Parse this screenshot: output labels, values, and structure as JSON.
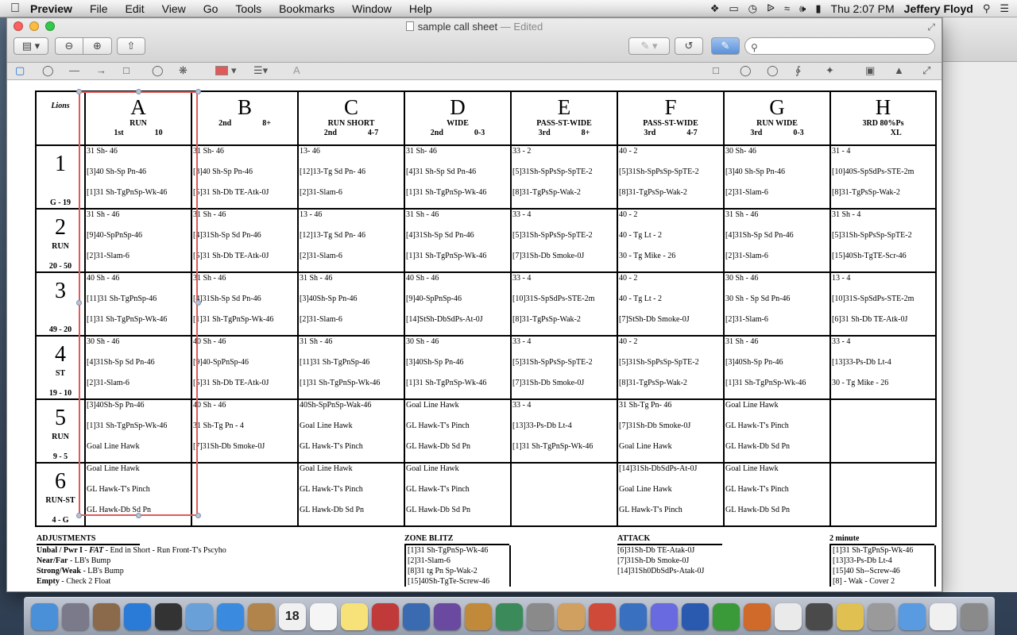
{
  "menubar": {
    "app": "Preview",
    "items": [
      "File",
      "Edit",
      "View",
      "Go",
      "Tools",
      "Bookmarks",
      "Window",
      "Help"
    ],
    "clock": "Thu 2:07 PM",
    "user": "Jeffery Floyd"
  },
  "window": {
    "title": "sample call sheet",
    "status": "Edited",
    "sep": "—"
  },
  "sheet": {
    "team": "Lions",
    "columns": [
      {
        "letter": "A",
        "name": "RUN",
        "down": "1st",
        "dist": "10"
      },
      {
        "letter": "B",
        "name": "",
        "down": "2nd",
        "dist": "8+"
      },
      {
        "letter": "C",
        "name": "RUN SHORT",
        "down": "2nd",
        "dist": "4-7"
      },
      {
        "letter": "D",
        "name": "WIDE",
        "down": "2nd",
        "dist": "0-3"
      },
      {
        "letter": "E",
        "name": "PASS-ST-WIDE",
        "down": "3rd",
        "dist": "8+"
      },
      {
        "letter": "F",
        "name": "PASS-ST-WIDE",
        "down": "3rd",
        "dist": "4-7"
      },
      {
        "letter": "G",
        "name": "RUN WIDE",
        "down": "3rd",
        "dist": "0-3"
      },
      {
        "letter": "H",
        "name": "3RD 80%Ps",
        "down": "",
        "dist": "XL"
      }
    ],
    "rows": [
      {
        "num": "1",
        "label": "",
        "range": "G - 19",
        "cells": [
          [
            "31 Sh- 46",
            "[3]40 Sh-Sp Pn-46",
            "[1]31 Sh-TgPnSp-Wk-46"
          ],
          [
            "31 Sh- 46",
            "[3]40 Sh-Sp Pn-46",
            "[5]31 Sh-Db TE-Atk-0J"
          ],
          [
            "13- 46",
            "[12]13-Tg Sd Pn- 46",
            "[2]31-Slam-6"
          ],
          [
            "31 Sh- 46",
            "[4]31 Sh-Sp Sd Pn-46",
            "[1]31 Sh-TgPnSp-Wk-46"
          ],
          [
            "33 - 2",
            "[5]31Sh-SpPsSp-SpTE-2",
            "[8]31-TgPsSp-Wak-2"
          ],
          [
            "40 - 2",
            "[5]31Sh-SpPsSp-SpTE-2",
            "[8]31-TgPsSp-Wak-2"
          ],
          [
            "30 Sh- 46",
            "[3]40 Sh-Sp Pn-46",
            "[2]31-Slam-6"
          ],
          [
            "31 - 4",
            "[10]40S-SpSdPs-STE-2m",
            "[8]31-TgPsSp-Wak-2"
          ]
        ]
      },
      {
        "num": "2",
        "label": "RUN",
        "range": "20 - 50",
        "cells": [
          [
            "31 Sh - 46",
            "[9]40-SpPnSp-46",
            "[2]31-Slam-6"
          ],
          [
            "31 Sh - 46",
            "[4]31Sh-Sp Sd Pn-46",
            "[5]31 Sh-Db TE-Atk-0J"
          ],
          [
            "13 - 46",
            "[12]13-Tg Sd Pn- 46",
            "[2]31-Slam-6"
          ],
          [
            "31 Sh - 46",
            "[4]31Sh-Sp Sd Pn-46",
            "[1]31 Sh-TgPnSp-Wk-46"
          ],
          [
            "33 - 4",
            "[5]31Sh-SpPsSp-SpTE-2",
            "[7]31Sh-Db Smoke-0J"
          ],
          [
            "40 - 2",
            "40 - Tg Lt - 2",
            "30 - Tg Mike - 26"
          ],
          [
            "31 Sh - 46",
            "[4]31Sh-Sp Sd Pn-46",
            "[2]31-Slam-6"
          ],
          [
            "31 Sh - 4",
            "[5]31Sh-SpPsSp-SpTE-2",
            "[15]40Sh-TgTE-Scr-46"
          ]
        ]
      },
      {
        "num": "3",
        "label": "",
        "range": "49 - 20",
        "cells": [
          [
            "40 Sh - 46",
            "[11]31 Sh-TgPnSp-46",
            "[1]31 Sh-TgPnSp-Wk-46"
          ],
          [
            "31 Sh - 46",
            "[4]31Sh-Sp Sd Pn-46",
            "[1]31 Sh-TgPnSp-Wk-46"
          ],
          [
            "31 Sh - 46",
            "[3]40Sh-Sp Pn-46",
            "[2]31-Slam-6"
          ],
          [
            "40 Sh - 46",
            "[9]40-SpPnSp-46",
            "[14]StSh-DbSdPs-At-0J"
          ],
          [
            "33 - 4",
            "[10]31S-SpSdPs-STE-2m",
            "[8]31-TgPsSp-Wak-2"
          ],
          [
            "40 - 2",
            "40 - Tg Lt - 2",
            "[7]StSh-Db Smoke-0J"
          ],
          [
            "30 Sh - 46",
            "30 Sh - Sp Sd Pn-46",
            "[2]31-Slam-6"
          ],
          [
            "13 - 4",
            "[10]31S-SpSdPs-STE-2m",
            "[6]31 Sh-Db TE-Atk-0J"
          ]
        ]
      },
      {
        "num": "4",
        "label": "ST",
        "range": "19 - 10",
        "cells": [
          [
            "30 Sh - 46",
            "[4]31Sh-Sp Sd Pn-46",
            "[2]31-Slam-6"
          ],
          [
            "40 Sh - 46",
            "[9]40-SpPnSp-46",
            "[5]31 Sh-Db TE-Atk-0J"
          ],
          [
            "31 Sh - 46",
            "[11]31 Sh-TgPnSp-46",
            "[1]31 Sh-TgPnSp-Wk-46"
          ],
          [
            "30 Sh - 46",
            "[3]40Sh-Sp Pn-46",
            "[1]31 Sh-TgPnSp-Wk-46"
          ],
          [
            "33 - 4",
            "[5]31Sh-SpPsSp-SpTE-2",
            "[7]31Sh-Db Smoke-0J"
          ],
          [
            "40 - 2",
            "[5]31Sh-SpPsSp-SpTE-2",
            "[8]31-TgPsSp-Wak-2"
          ],
          [
            "31 Sh - 46",
            "[3]40Sh-Sp Pn-46",
            "[1]31 Sh-TgPnSp-Wk-46"
          ],
          [
            "33 - 4",
            "[13]33-Ps-Db Lt-4",
            "30 - Tg Mike - 26"
          ]
        ]
      },
      {
        "num": "5",
        "label": "RUN",
        "range": "9 - 5",
        "cells": [
          [
            "[3]40Sh-Sp Pn-46",
            "[1]31 Sh-TgPnSp-Wk-46",
            "Goal Line Hawk"
          ],
          [
            "40 Sh - 46",
            "31 Sh-Tg Pn - 4",
            "[7]31Sh-Db Smoke-0J"
          ],
          [
            "40Sh-SpPnSp-Wak-46",
            "Goal Line Hawk",
            "GL Hawk-T's Pinch"
          ],
          [
            "Goal Line Hawk",
            "GL Hawk-T's Pinch",
            "GL Hawk-Db Sd Pn"
          ],
          [
            "33 - 4",
            "[13]33-Ps-Db Lt-4",
            "[1]31 Sh-TgPnSp-Wk-46"
          ],
          [
            "31 Sh-Tg Pn- 46",
            "[7]31Sh-Db Smoke-0J",
            "Goal Line Hawk"
          ],
          [
            "Goal Line Hawk",
            "GL Hawk-T's Pinch",
            "GL Hawk-Db Sd Pn"
          ],
          []
        ]
      },
      {
        "num": "6",
        "label": "RUN-ST",
        "range": "4 - G",
        "cells": [
          [
            "Goal Line Hawk",
            "GL Hawk-T's Pinch",
            "GL Hawk-Db Sd Pn"
          ],
          [],
          [
            "Goal Line Hawk",
            "GL Hawk-T's Pinch",
            "GL Hawk-Db Sd Pn"
          ],
          [
            "Goal Line Hawk",
            "GL Hawk-T's Pinch",
            "GL Hawk-Db Sd Pn"
          ],
          [],
          [
            "[14]31Sh-DbSdPs-At-0J",
            "Goal Line Hawk",
            "GL Hawk-T's Pinch"
          ],
          [
            "Goal Line Hawk",
            "GL Hawk-T's Pinch",
            "GL Hawk-Db Sd Pn"
          ],
          []
        ]
      }
    ]
  },
  "adjustments": {
    "title": "ADJUSTMENTS",
    "lines": [
      {
        "key": "Unbal / Pwr I",
        "em": "FAT",
        "text": " - End in Short - Run Front-T's Pscyho"
      },
      {
        "key": "Near/Far",
        "em": "",
        "text": " - LB's Bump"
      },
      {
        "key": "Strong/Weak",
        "em": "",
        "text": " - LB's Bump"
      },
      {
        "key": "Empty",
        "em": "",
        "text": " - Check 2 Float"
      }
    ]
  },
  "zone_blitz": {
    "title": "ZONE BLITZ",
    "lines": [
      "[1]31 Sh-TgPnSp-Wk-46",
      "[2]31-Slam-6",
      "[8]31 tg Pn Sp-Wak-2",
      "[15]40Sh-TgTe-Screw-46"
    ]
  },
  "attack": {
    "title": "ATTACK",
    "lines": [
      "[6]31Sh-Db TE-Atak-0J",
      "[7]31Sh-Db Smoke-0J",
      "[14]31Sh0DbSdPs-Atak-0J"
    ]
  },
  "two_minute": {
    "title": "2 minute",
    "lines": [
      "[1]31 Sh-TgPnSp-Wk-46",
      "[13]33-Ps-Db Lt-4",
      "[15]40 Sh--Screw-46",
      "[8] - Wak - Cover 2"
    ]
  },
  "colors": {
    "selection": "#e05a5a",
    "accent": "#1a6fd6"
  },
  "dock": {
    "icons": [
      "finder-icon",
      "launchpad-icon",
      "preview-icon",
      "app-store-icon",
      "dashboard-icon",
      "mail-icon",
      "safari-icon",
      "address-book-icon",
      "calendar-icon",
      "reminders-icon",
      "notes-icon",
      "photo-booth-icon",
      "iphoto-icon",
      "imovie-icon",
      "garageband-icon",
      "time-machine-icon",
      "system-prefs-icon",
      "preview-app-icon",
      "dvd-icon",
      "quicktime-icon",
      "itunes-icon",
      "word-icon",
      "excel-icon",
      "powerpoint-icon",
      "script-icon",
      "facetime-icon",
      "messages-icon",
      "calculator-icon",
      "network-icon",
      "document-icon",
      "trash-icon"
    ],
    "calendar_day": "18"
  }
}
